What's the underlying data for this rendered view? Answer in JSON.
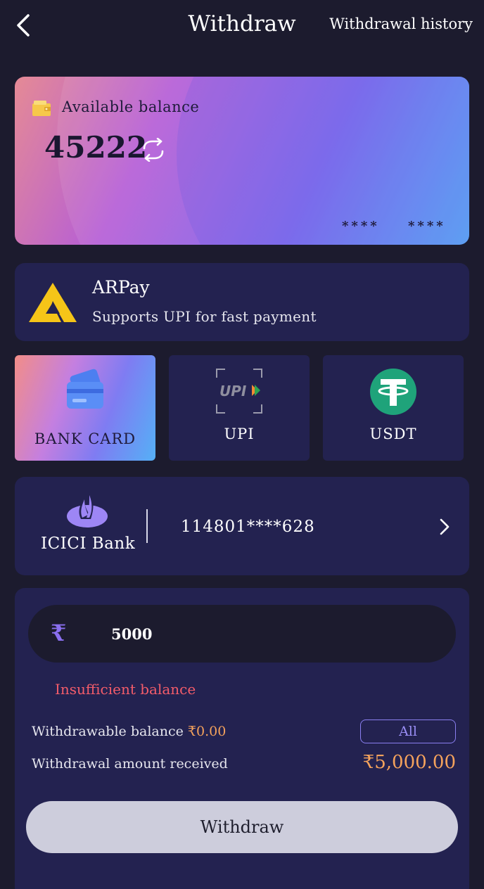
{
  "header": {
    "title": "Withdraw",
    "history_link": "Withdrawal history",
    "back_icon": "chevron-left-icon"
  },
  "balance_card": {
    "label": "Available balance",
    "value": "45222",
    "masked_1": "****",
    "masked_2": "****",
    "wallet_icon": "wallet-icon",
    "refresh_icon": "refresh-icon",
    "gradient": [
      "#e58a95",
      "#b65ed6",
      "#7a62ec",
      "#52a8f7"
    ]
  },
  "provider": {
    "name": "ARPay",
    "description": "Supports UPI for fast payment",
    "logo_color": "#f5c518"
  },
  "methods": [
    {
      "label": "BANK CARD",
      "icon": "bank-card-icon",
      "selected": true
    },
    {
      "label": "UPI",
      "icon": "upi-logo-icon",
      "selected": false
    },
    {
      "label": "USDT",
      "icon": "tether-icon",
      "selected": false
    }
  ],
  "account": {
    "bank_name": "ICICI Bank",
    "account_number": "114801****628",
    "logo_icon": "bank-flame-icon"
  },
  "amount_form": {
    "currency_symbol": "₹",
    "amount_value": "5000",
    "error": "Insufficient balance",
    "withdrawable_label": "Withdrawable balance",
    "withdrawable_value": "₹0.00",
    "all_button": "All",
    "received_label": "Withdrawal amount received",
    "received_value": "₹5,000.00",
    "submit_button": "Withdraw"
  },
  "colors": {
    "background": "#1c1b2e",
    "panel": "#232250",
    "accent_orange": "#f6a35c",
    "error_red": "#f35c6a",
    "accent_purple": "#8a7ff0"
  }
}
